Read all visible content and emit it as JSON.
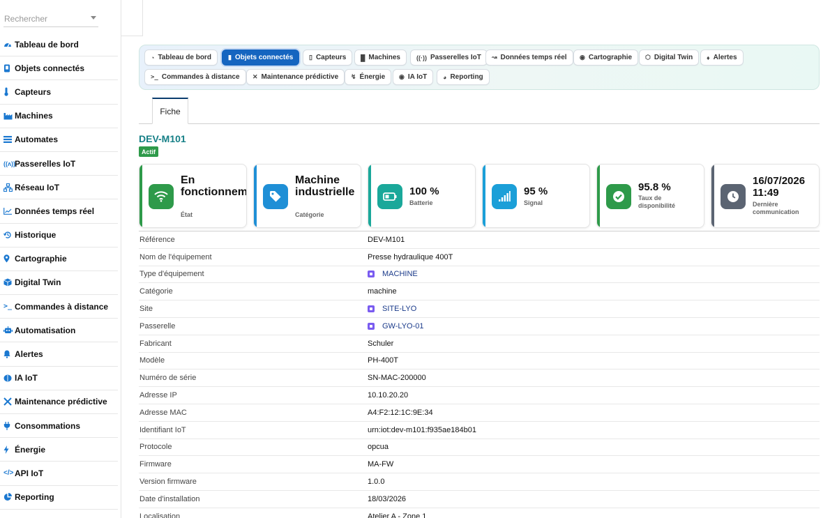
{
  "search": {
    "placeholder": "Rechercher"
  },
  "sidebar": {
    "items": [
      {
        "label": "Tableau de bord",
        "icon": "gauge-icon"
      },
      {
        "label": "Objets connectés",
        "icon": "device-icon"
      },
      {
        "label": "Capteurs",
        "icon": "thermometer-icon"
      },
      {
        "label": "Machines",
        "icon": "factory-icon"
      },
      {
        "label": "Automates",
        "icon": "list-icon"
      },
      {
        "label": "Passerelles IoT",
        "icon": "broadcast-icon"
      },
      {
        "label": "Réseau IoT",
        "icon": "network-icon"
      },
      {
        "label": "Données temps réel",
        "icon": "chart-line-icon"
      },
      {
        "label": "Historique",
        "icon": "history-icon"
      },
      {
        "label": "Cartographie",
        "icon": "map-pin-icon"
      },
      {
        "label": "Digital Twin",
        "icon": "cube-icon"
      },
      {
        "label": "Commandes à distance",
        "icon": "terminal-icon"
      },
      {
        "label": "Automatisation",
        "icon": "robot-icon"
      },
      {
        "label": "Alertes",
        "icon": "bell-icon"
      },
      {
        "label": "IA IoT",
        "icon": "brain-icon"
      },
      {
        "label": "Maintenance prédictive",
        "icon": "tools-icon"
      },
      {
        "label": "Consommations",
        "icon": "plug-icon"
      },
      {
        "label": "Énergie",
        "icon": "bolt-icon"
      },
      {
        "label": "API IoT",
        "icon": "code-icon"
      },
      {
        "label": "Reporting",
        "icon": "pie-chart-icon"
      }
    ]
  },
  "toolbar": {
    "chips": [
      {
        "label": "Tableau de bord",
        "icon": "gauge-icon",
        "active": false
      },
      {
        "label": "Objets connectés",
        "icon": "device-icon",
        "active": true
      },
      {
        "label": "Capteurs",
        "icon": "thermometer-icon",
        "active": false
      },
      {
        "label": "Machines",
        "icon": "factory-icon",
        "active": false
      },
      {
        "label": "Passerelles IoT",
        "icon": "broadcast-icon",
        "active": false
      },
      {
        "label": "Données temps réel",
        "icon": "chart-line-icon",
        "active": false
      },
      {
        "label": "Cartographie",
        "icon": "map-pin-icon",
        "active": false
      },
      {
        "label": "Digital Twin",
        "icon": "cube-icon",
        "active": false
      },
      {
        "label": "Alertes",
        "icon": "bell-icon",
        "active": false
      },
      {
        "label": "Commandes à distance",
        "icon": "terminal-icon",
        "active": false
      },
      {
        "label": "Maintenance prédictive",
        "icon": "tools-icon",
        "active": false
      },
      {
        "label": "Énergie",
        "icon": "bolt-icon",
        "active": false
      },
      {
        "label": "IA IoT",
        "icon": "brain-icon",
        "active": false
      },
      {
        "label": "Reporting",
        "icon": "pie-chart-icon",
        "active": false
      }
    ]
  },
  "tabs": [
    {
      "label": "Fiche"
    }
  ],
  "device": {
    "title": "DEV-M101",
    "status_badge": "Actif"
  },
  "cards": [
    {
      "value": "En fonctionnement",
      "label": "État",
      "icon": "wifi-icon",
      "accent": "#2e9a4a"
    },
    {
      "value": "Machine industrielle",
      "label": "Catégorie",
      "icon": "tag-icon",
      "accent": "#1f8fd6"
    },
    {
      "value": "100 %",
      "label": "Batterie",
      "icon": "battery-icon",
      "accent": "#1aa89a"
    },
    {
      "value": "95 %",
      "label": "Signal",
      "icon": "signal-icon",
      "accent": "#1b9fd8"
    },
    {
      "value": "95.8 %",
      "label": "Taux de disponibilité",
      "icon": "check-circle-icon",
      "accent": "#2e9a4a"
    },
    {
      "value": "16/07/2026 11:49",
      "label": "Dernière communication",
      "icon": "clock-icon",
      "accent": "#5b6472"
    }
  ],
  "details": [
    {
      "key": "Référence",
      "value": "DEV-M101",
      "link": false
    },
    {
      "key": "Nom de l'équipement",
      "value": "Presse hydraulique 400T",
      "link": false
    },
    {
      "key": "Type d'équipement",
      "value": "MACHINE",
      "link": true
    },
    {
      "key": "Catégorie",
      "value": "machine",
      "link": false
    },
    {
      "key": "Site",
      "value": "SITE-LYO",
      "link": true
    },
    {
      "key": "Passerelle",
      "value": "GW-LYO-01",
      "link": true
    },
    {
      "key": "Fabricant",
      "value": "Schuler",
      "link": false
    },
    {
      "key": "Modèle",
      "value": "PH-400T",
      "link": false
    },
    {
      "key": "Numéro de série",
      "value": "SN-MAC-200000",
      "link": false
    },
    {
      "key": "Adresse IP",
      "value": "10.10.20.20",
      "link": false
    },
    {
      "key": "Adresse MAC",
      "value": "A4:F2:12:1C:9E:34",
      "link": false
    },
    {
      "key": "Identifiant IoT",
      "value": "urn:iot:dev-m101:f935ae184b01",
      "link": false
    },
    {
      "key": "Protocole",
      "value": "opcua",
      "link": false
    },
    {
      "key": "Firmware",
      "value": "MA-FW",
      "link": false
    },
    {
      "key": "Version firmware",
      "value": "1.0.0",
      "link": false
    },
    {
      "key": "Date d'installation",
      "value": "18/03/2026",
      "link": false
    },
    {
      "key": "Localisation",
      "value": "Atelier A - Zone 1",
      "link": false
    }
  ]
}
